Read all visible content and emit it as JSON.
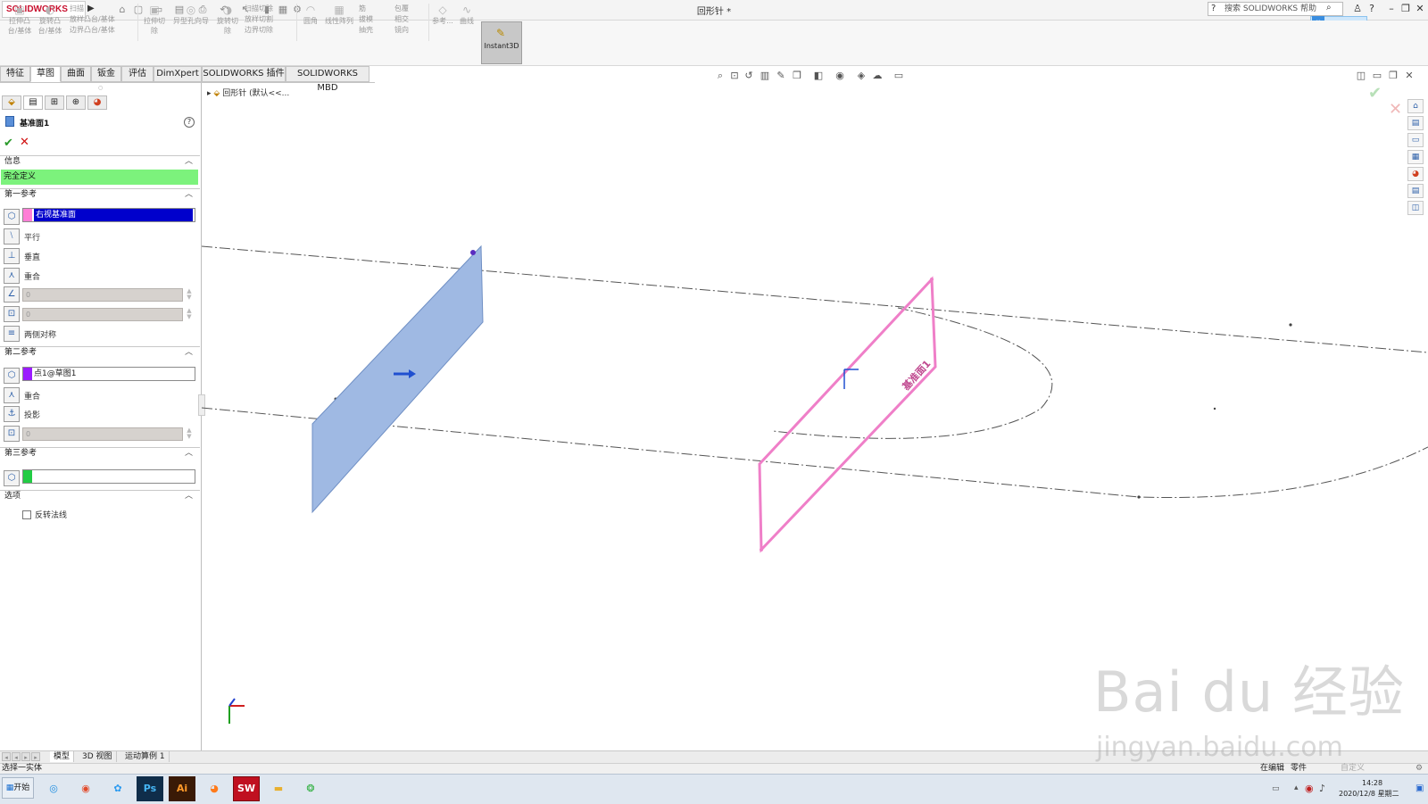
{
  "titlebar": {
    "logo": "SOLIDWORKS",
    "document_title": "回形针 *",
    "search_placeholder": "搜索 SOLIDWORKS 帮助"
  },
  "ribbon": {
    "buttons": [
      {
        "label": "拉伸凸\n台/基体"
      },
      {
        "label": "旋转凸\n台/基体"
      },
      {
        "label": "扫描"
      },
      {
        "label": "放样凸台/基体"
      },
      {
        "label": "边界凸台/基体"
      },
      {
        "label": "拉伸切\n除"
      },
      {
        "label": "异型孔向导"
      },
      {
        "label": "旋转切\n除"
      },
      {
        "label": "扫描切除"
      },
      {
        "label": "放样切割"
      },
      {
        "label": "边界切除"
      },
      {
        "label": "圆角"
      },
      {
        "label": "线性阵列"
      },
      {
        "label": "筋"
      },
      {
        "label": "拔模"
      },
      {
        "label": "抽壳"
      },
      {
        "label": "包覆"
      },
      {
        "label": "相交"
      },
      {
        "label": "镜向"
      },
      {
        "label": "参考..."
      },
      {
        "label": "曲线"
      }
    ],
    "instant3d": "Instant3D"
  },
  "tabs": [
    "特征",
    "草图",
    "曲面",
    "钣金",
    "评估",
    "DimXpert",
    "SOLIDWORKS 插件",
    "SOLIDWORKS MBD"
  ],
  "panel": {
    "title": "基准面1",
    "sections": {
      "info": "信息",
      "first_ref": "第一参考",
      "second_ref": "第二参考",
      "third_ref": "第三参考",
      "options": "选项"
    },
    "status": "完全定义",
    "first_ref_value": "右视基准面",
    "first_ref_options": [
      "平行",
      "垂直",
      "重合"
    ],
    "angle_value": "0",
    "distance_value": "0",
    "symmetric_label": "两侧对称",
    "second_ref_value": "点1@草图1",
    "second_ref_options": [
      "重合",
      "投影"
    ],
    "second_value": "0",
    "reverse_label": "反转法线",
    "colors": {
      "first": "#ff7fd6",
      "second": "#9b1bff",
      "third": "#22cc44"
    }
  },
  "graphics": {
    "breadcrumb_part": "回形针",
    "breadcrumb_config": "(默认<<..."
  },
  "bottom_tabs": [
    "模型",
    "3D 视图",
    "运动算例 1"
  ],
  "statusbar": {
    "left": "选择一实体",
    "editing": "在编辑",
    "mode": "零件",
    "custom": "自定义"
  },
  "taskbar": {
    "start": "开始",
    "time": "14:28",
    "date": "2020/12/8 星期二"
  },
  "watermark": {
    "brand": "Bai du 经验",
    "site": "jingyan.baidu.com"
  }
}
